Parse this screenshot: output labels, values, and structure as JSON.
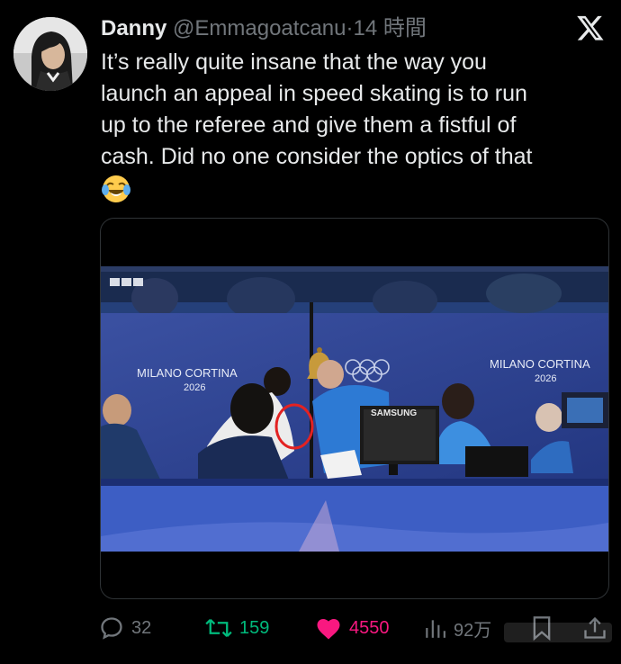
{
  "tweet": {
    "author_name": "Danny",
    "author_handle": "@Emmagoatcanu",
    "separator": "·",
    "timestamp": "14 時間",
    "text_lines": [
      "It’s really quite insane that the way you",
      "launch an appeal in speed skating is to run",
      "up to the referee and give them a fistful of",
      "cash. Did no one consider the optics of that"
    ],
    "emoji": "face-with-tears-of-joy"
  },
  "media": {
    "watermark": "BBC",
    "banner_text_left": "MILANO CORTINA",
    "banner_year_left": "2026",
    "banner_text_right": "MILANO CORTINA",
    "banner_year_right": "2026",
    "monitor_brand": "SAMSUNG"
  },
  "actions": {
    "replies": "32",
    "retweets": "159",
    "likes": "4550",
    "views": "92万"
  },
  "colors": {
    "background": "#000000",
    "text_primary": "#e7e9ea",
    "text_secondary": "#71767b",
    "retweet": "#00ba7c",
    "like": "#f91880",
    "border": "#2f3336"
  },
  "icons": [
    "x-logo-icon",
    "reply-icon",
    "retweet-icon",
    "heart-icon",
    "views-icon",
    "bookmark-icon",
    "share-icon"
  ]
}
